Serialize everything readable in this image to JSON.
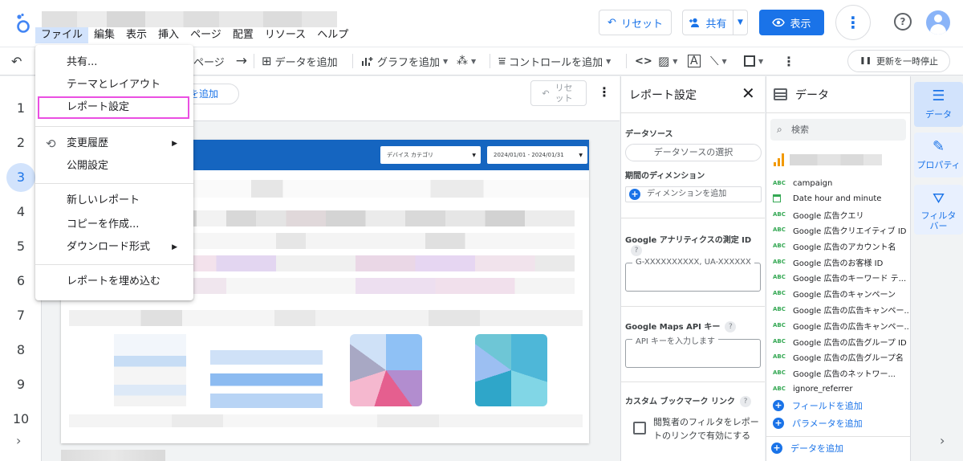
{
  "header": {
    "menus": [
      "ファイル",
      "編集",
      "表示",
      "挿入",
      "ページ",
      "配置",
      "リソース",
      "ヘルプ"
    ],
    "reset_label": "リセット",
    "share_label": "共有",
    "view_label": "表示"
  },
  "toolbar": {
    "page_label": "ページ",
    "add_data": "データを追加",
    "add_chart": "グラフを追加",
    "add_control": "コントロールを追加",
    "pause_updates": "更新を一時停止"
  },
  "pages": [
    "1",
    "2",
    "3",
    "4",
    "5",
    "6",
    "7",
    "8",
    "9",
    "10"
  ],
  "active_page": "3",
  "canvas": {
    "add_control_suffix": "を追加",
    "reset_label": "リセット",
    "device_category": "デバイス カテゴリ",
    "date_range": "2024/01/01 - 2024/01/31"
  },
  "file_menu": {
    "share": "共有...",
    "theme_layout": "テーマとレイアウト",
    "report_settings": "レポート設定",
    "version_history": "変更履歴",
    "publish_settings": "公開設定",
    "new_report": "新しいレポート",
    "make_copy": "コピーを作成...",
    "download_format": "ダウンロード形式",
    "embed_report": "レポートを埋め込む"
  },
  "report_settings": {
    "title": "レポート設定",
    "data_source_label": "データソース",
    "select_data_source": "データソースの選択",
    "date_dimension_label": "期間のディメンション",
    "add_dimension": "ディメンションを追加",
    "ga_id_label": "Google アナリティクスの測定 ID",
    "ga_id_placeholder": "G-XXXXXXXXXX, UA-XXXXXX",
    "maps_key_label": "Google Maps API キー",
    "maps_key_placeholder": "API キーを入力します",
    "bookmark_label": "カスタム ブックマーク リンク",
    "bookmark_checkbox": "閲覧者のフィルタをレポートのリンクで有効にする"
  },
  "data_panel": {
    "title": "データ",
    "search_placeholder": "検索",
    "type_text": "ABC",
    "fields": [
      "campaign",
      "Date hour and minute",
      "Google 広告クエリ",
      "Google 広告クリエイティブ ID",
      "Google 広告のアカウント名",
      "Google 広告のお客様 ID",
      "Google 広告のキーワード テ...",
      "Google 広告のキャンペーン",
      "Google 広告の広告キャンペー...",
      "Google 広告の広告キャンペー...",
      "Google 広告の広告グループ ID",
      "Google 広告の広告グループ名",
      "Google 広告のネットワー...",
      "ignore_referrer"
    ],
    "add_field": "フィールドを追加",
    "add_parameter": "パラメータを追加",
    "add_data": "データを追加"
  },
  "right_rail": {
    "data_tab": "データ",
    "properties_tab": "プロパティ",
    "filter_bar_tab": "フィルタバー"
  }
}
